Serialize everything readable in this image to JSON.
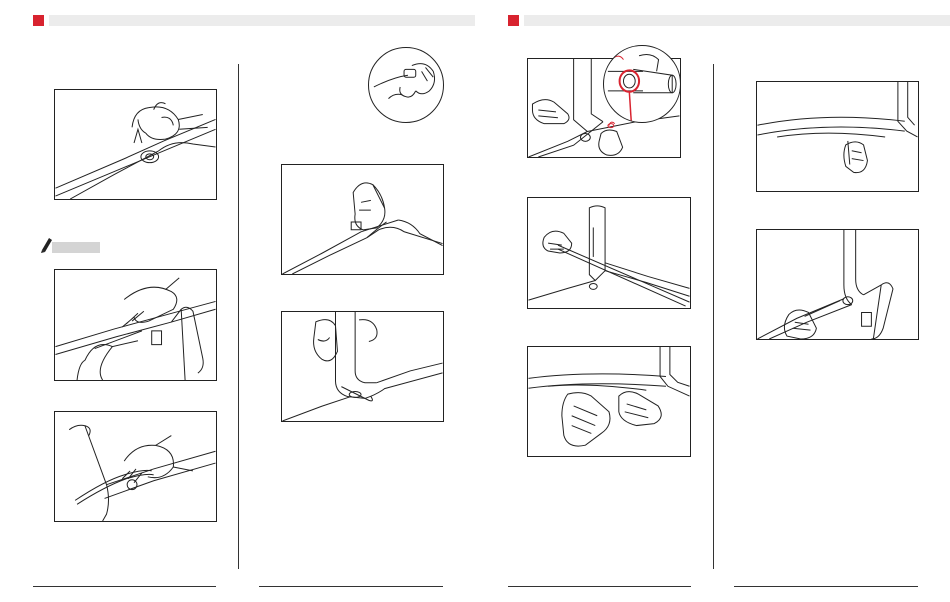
{
  "colors": {
    "section_marker": "#d8232f",
    "header_bar": "#ececec",
    "note_bar": "#d4d4d4",
    "line_art": "#222222"
  },
  "icons": {
    "note": "pencil-icon"
  }
}
